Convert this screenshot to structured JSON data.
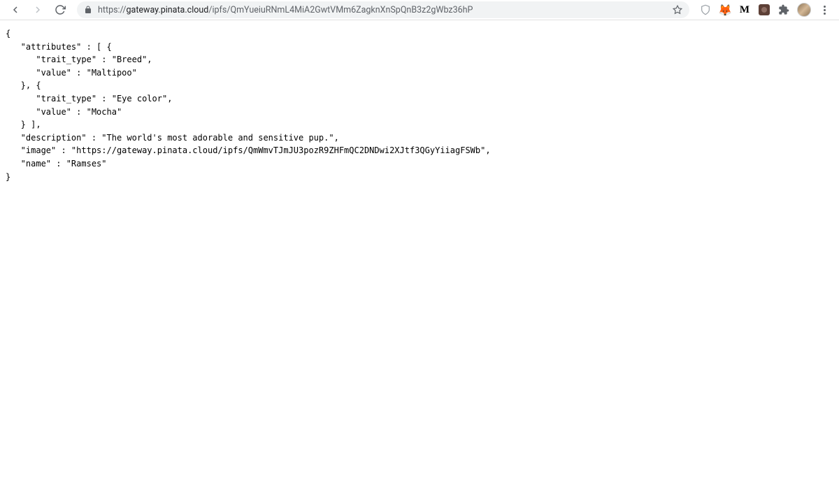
{
  "url": {
    "scheme": "https://",
    "host": "gateway.pinata.cloud",
    "path": "/ipfs/QmYueiuRNmL4MiA2GwtVMm6ZagknXnSpQnB3z2gWbz36hP"
  },
  "json_content": {
    "line1": "{",
    "line2": "   \"attributes\" : [ {",
    "line3": "      \"trait_type\" : \"Breed\",",
    "line4": "      \"value\" : \"Maltipoo\"",
    "line5": "   }, {",
    "line6": "      \"trait_type\" : \"Eye color\",",
    "line7": "      \"value\" : \"Mocha\"",
    "line8": "   } ],",
    "line9": "   \"description\" : \"The world's most adorable and sensitive pup.\",",
    "line10": "   \"image\" : \"https://gateway.pinata.cloud/ipfs/QmWmvTJmJU3pozR9ZHFmQC2DNDwi2XJtf3QGyYiiagFSWb\",",
    "line11": "   \"name\" : \"Ramses\"",
    "line12": "}"
  },
  "extensions": {
    "m_label": "M"
  }
}
